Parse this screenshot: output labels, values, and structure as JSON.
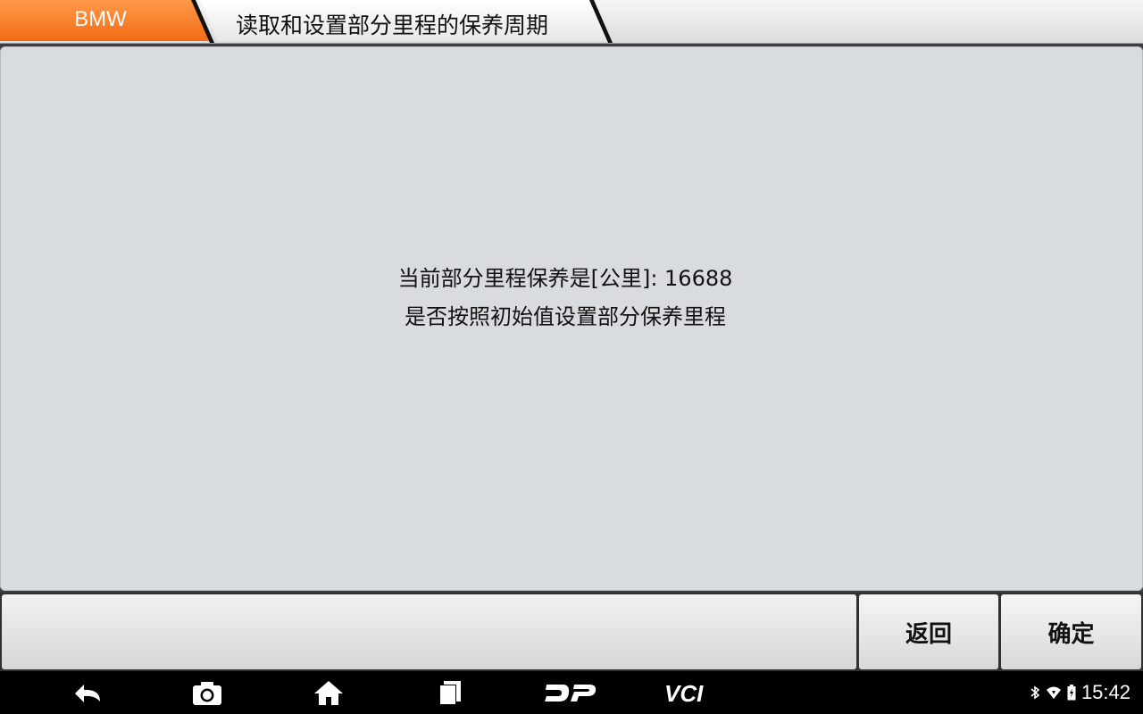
{
  "header": {
    "brand": "BMW",
    "page_title": "读取和设置部分里程的保养周期"
  },
  "message": {
    "line1": "当前部分里程保养是[公里]: 16688",
    "line2": "是否按照初始值设置部分保养里程"
  },
  "toolbar": {
    "back_label": "返回",
    "confirm_label": "确定"
  },
  "sysbar": {
    "icons": [
      "back-icon",
      "camera-icon",
      "home-icon",
      "recent-apps-icon",
      "dp-icon",
      "vci-icon"
    ],
    "status_icons": [
      "bluetooth-icon",
      "wifi-icon",
      "battery-icon"
    ],
    "time": "15:42"
  },
  "colors": {
    "brand_tab": "#f26a12",
    "content_bg": "#d9dcdf",
    "toolbar_bg": "#2f3134",
    "sysbar_bg": "#000000"
  }
}
